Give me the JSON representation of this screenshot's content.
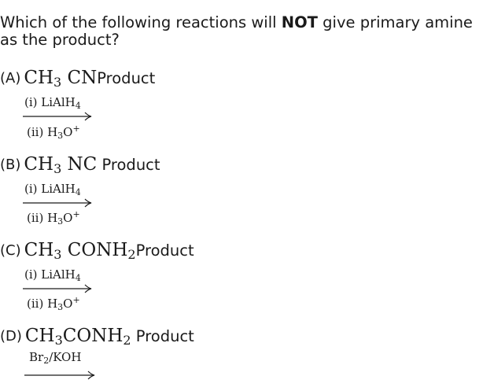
{
  "question": {
    "pre": "Which of the following reactions will ",
    "emphasis": "NOT",
    "post": " give primary amine as the product?"
  },
  "options": [
    {
      "label": "(A)",
      "formula": [
        "CH",
        "3",
        " CN"
      ],
      "product": "Product",
      "reagent_top": [
        "(i)  LiAlH",
        "4"
      ],
      "reagent_bottom": [
        "(ii)  H",
        "3",
        "O",
        "+"
      ]
    },
    {
      "label": "(B)",
      "formula": [
        "CH",
        "3",
        " NC"
      ],
      "product": "Product",
      "reagent_top": [
        "(i)  LiAlH",
        "4"
      ],
      "reagent_bottom": [
        "(ii)  H",
        "3",
        "O",
        "+"
      ]
    },
    {
      "label": "(C)",
      "formula": [
        "CH",
        "3",
        " CONH",
        "2"
      ],
      "product": "Product",
      "reagent_top": [
        "(i)  LiAlH",
        "4"
      ],
      "reagent_bottom": [
        "(ii)  H",
        "3",
        "O",
        "+"
      ]
    },
    {
      "label": "(D)",
      "formula": [
        "CH",
        "3",
        "CONH",
        "2"
      ],
      "product": "Product",
      "reagent_top": [
        "Br",
        "2",
        "/KOH"
      ]
    }
  ]
}
